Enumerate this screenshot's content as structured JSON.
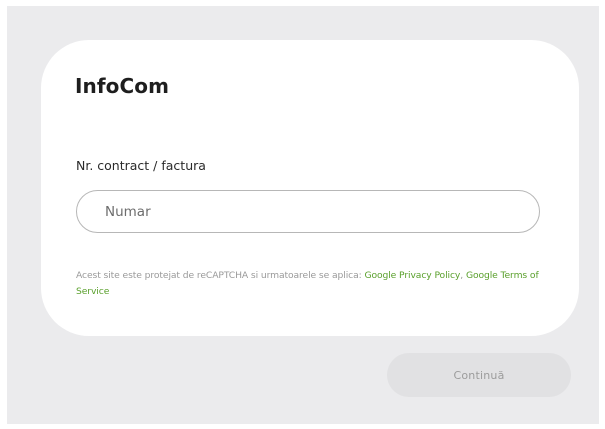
{
  "card": {
    "brand": "InfoCom",
    "field_label": "Nr. contract / factura",
    "input": {
      "value": "",
      "placeholder": "Numar"
    },
    "notice": {
      "text": "Acest site este protejat de reCAPTCHA si urmatoarele se aplica: ",
      "privacy_link": "Google Privacy Policy",
      "separator": ", ",
      "terms_link": "Google Terms of Service"
    }
  },
  "actions": {
    "continue_label": "Continuă"
  },
  "colors": {
    "background": "#ebebed",
    "card": "#ffffff",
    "link": "#5aa02c",
    "button_disabled": "#e1e1e3"
  }
}
